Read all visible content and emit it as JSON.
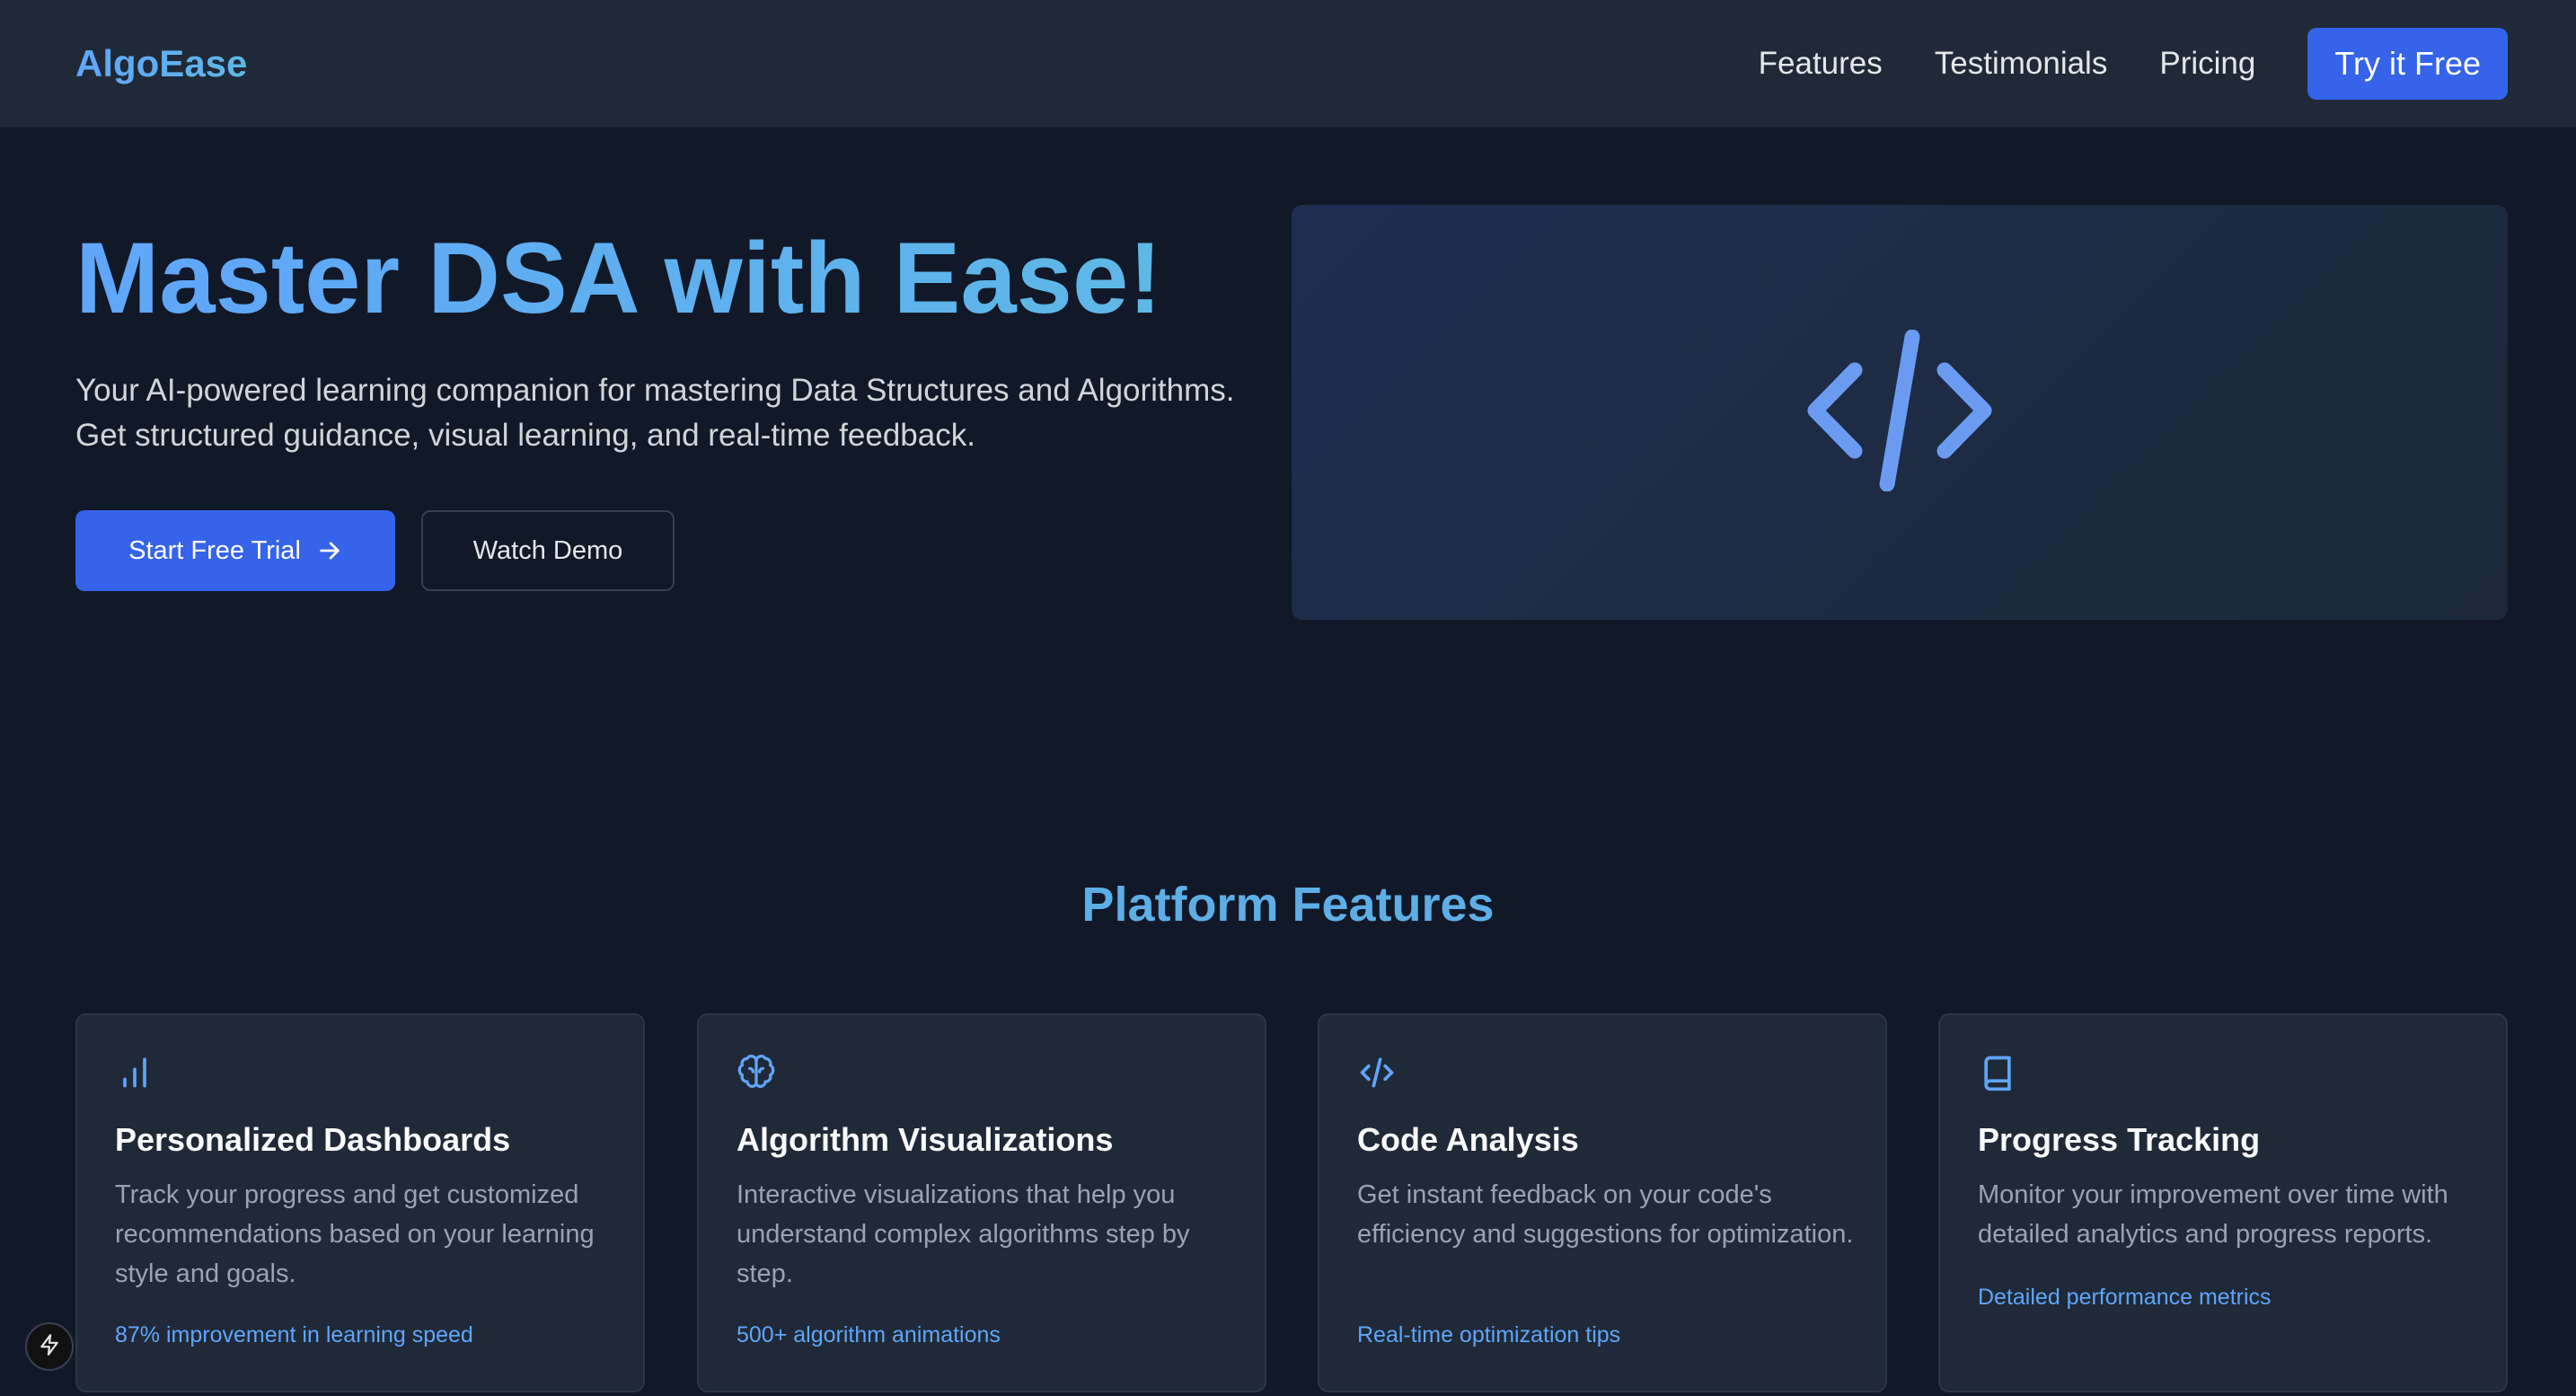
{
  "nav": {
    "logo": "AlgoEase",
    "links": [
      "Features",
      "Testimonials",
      "Pricing"
    ],
    "cta": "Try it Free"
  },
  "hero": {
    "title": "Master DSA with Ease!",
    "subtitle_line1": "Your AI-powered learning companion for mastering Data Structures and Algorithms.",
    "subtitle_line2": "Get structured guidance, visual learning, and real-time feedback.",
    "primary_button": "Start Free Trial",
    "secondary_button": "Watch Demo",
    "panel_icon": "code-icon"
  },
  "features": {
    "title": "Platform Features",
    "cards": [
      {
        "icon": "bar-chart-icon",
        "title": "Personalized Dashboards",
        "description": "Track your progress and get customized recommendations based on your learning style and goals.",
        "meta": "87% improvement in learning speed"
      },
      {
        "icon": "brain-icon",
        "title": "Algorithm Visualizations",
        "description": "Interactive visualizations that help you understand complex algorithms step by step.",
        "meta": "500+ algorithm animations"
      },
      {
        "icon": "code-icon",
        "title": "Code Analysis",
        "description": "Get instant feedback on your code's efficiency and suggestions for optimization.",
        "meta": "Real-time optimization tips"
      },
      {
        "icon": "book-icon",
        "title": "Progress Tracking",
        "description": "Monitor your improvement over time with detailed analytics and progress reports.",
        "meta": "Detailed performance metrics"
      }
    ]
  },
  "colors": {
    "background": "#111827",
    "navbar": "#1f2937",
    "accent": "#3563e9",
    "gradient_text": "#60a5fa",
    "card": "#1f2937"
  }
}
